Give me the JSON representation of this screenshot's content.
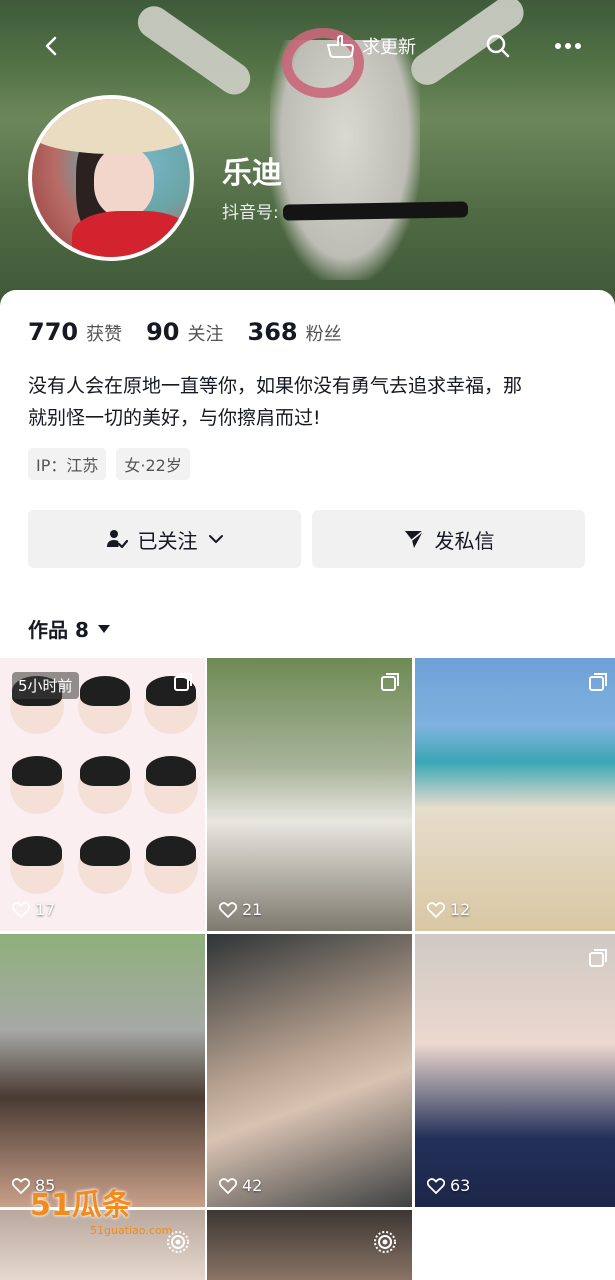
{
  "top_bar": {
    "update_label": "求更新"
  },
  "profile": {
    "nickname": "乐迪",
    "douyin_id_label": "抖音号:",
    "stats": [
      {
        "num": "770",
        "label": "获赞"
      },
      {
        "num": "90",
        "label": "关注"
      },
      {
        "num": "368",
        "label": "粉丝"
      }
    ],
    "bio_line1": "没有人会在原地一直等你，如果你没有勇气去追求幸福，那",
    "bio_line2": "就别怪一切的美好，与你擦肩而过!",
    "tags": [
      "IP：江苏",
      "女·22岁"
    ]
  },
  "actions": {
    "follow_label": "已关注",
    "message_label": "发私信"
  },
  "works": {
    "label": "作品 8"
  },
  "grid": [
    {
      "likes": "17",
      "time": "5小时前"
    },
    {
      "likes": "21"
    },
    {
      "likes": "12"
    },
    {
      "likes": "85"
    },
    {
      "likes": "42"
    },
    {
      "likes": "63"
    }
  ],
  "watermark": {
    "main": "51瓜条",
    "sub": "51guatiao.com"
  }
}
